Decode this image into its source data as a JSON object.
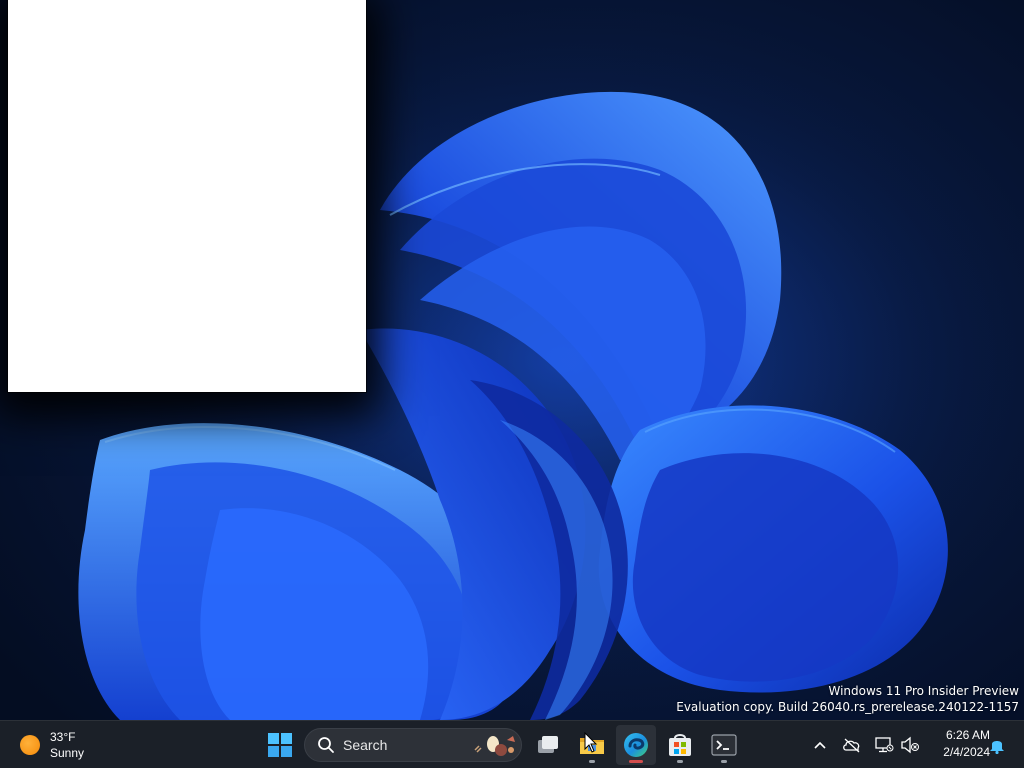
{
  "desktop": {
    "watermark": {
      "line1": "Windows 11 Pro Insider Preview",
      "line2": "Evaluation copy. Build 26040.rs_prerelease.240122-1157"
    }
  },
  "taskbar": {
    "weather": {
      "temp": "33°F",
      "condition": "Sunny",
      "icon": "sun-icon"
    },
    "search": {
      "label": "Search"
    },
    "pinned_apps": [
      {
        "name": "Task View",
        "icon": "task-view-icon"
      },
      {
        "name": "File Explorer",
        "icon": "folder-icon"
      },
      {
        "name": "Microsoft Edge",
        "icon": "edge-icon",
        "active": true
      },
      {
        "name": "Microsoft Store",
        "icon": "store-icon"
      },
      {
        "name": "Terminal",
        "icon": "terminal-icon"
      }
    ],
    "tray": {
      "icons": [
        "chevron-up-icon",
        "cloud-offline-icon",
        "network-disconnected-icon",
        "volume-muted-icon",
        "bell-icon"
      ]
    },
    "clock": {
      "time": "6:26 AM",
      "date": "2/4/2024"
    }
  },
  "colors": {
    "taskbar_bg": "#1b2028",
    "accent_blue": "#2f7dff",
    "window_bg": "#ffffff"
  }
}
